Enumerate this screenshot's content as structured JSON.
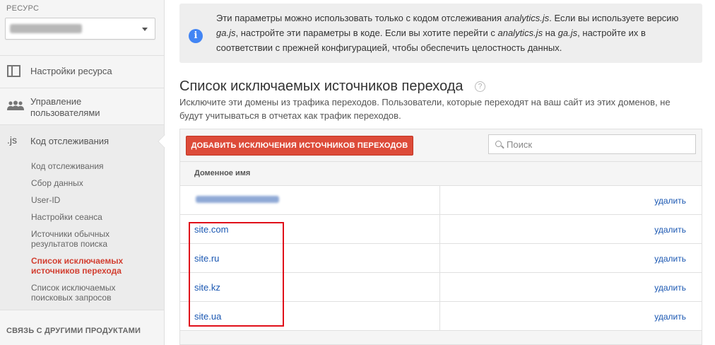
{
  "sidebar": {
    "resource_label": "РЕСУРС",
    "resource_value_blurred": "",
    "sections": {
      "resource_settings": "Настройки ресурса",
      "user_management": "Управление пользователями",
      "tracking_code": "Код отслеживания",
      "tracking_code_icon": ".js"
    },
    "sub_items": [
      "Код отслеживания",
      "Сбор данных",
      "User-ID",
      "Настройки сеанса",
      "Источники обычных результатов поиска",
      "Список исключаемых источников перехода",
      "Список исключаемых поисковых запросов"
    ],
    "active_sub_item": 5,
    "related_products_label": "СВЯЗЬ С ДРУГИМИ ПРОДУКТАМИ"
  },
  "info": {
    "text_1": "Эти параметры можно использовать только с кодом отслеживания ",
    "code_1": "analytics.js",
    "text_2": ". Если вы используете версию ",
    "code_2": "ga.js",
    "text_3": ", настройте эти параметры в коде. Если вы хотите перейти с ",
    "code_3": "analytics.js",
    "text_4": " на ",
    "code_4": "ga.js",
    "text_5": ", настройте их в соответствии с прежней конфигурацией, чтобы обеспечить целостность данных.",
    "icon": "i"
  },
  "main": {
    "title": "Список исключаемых источников перехода",
    "help_icon": "?",
    "description": "Исключите эти домены из трафика переходов. Пользователи, которые переходят на ваш сайт из этих доменов, не будут учитываться в отчетах как трафик переходов.",
    "add_button": "ДОБАВИТЬ ИСКЛЮЧЕНИЯ ИСТОЧНИКОВ ПЕРЕХОДОВ",
    "search_placeholder": "Поиск",
    "column_header": "Доменное имя",
    "rows": [
      {
        "domain": "",
        "blurred": true,
        "action": "удалить"
      },
      {
        "domain": "site.com",
        "action": "удалить"
      },
      {
        "domain": "site.ru",
        "action": "удалить"
      },
      {
        "domain": "site.kz",
        "action": "удалить"
      },
      {
        "domain": "site.ua",
        "action": "удалить"
      }
    ]
  },
  "colors": {
    "accent_red": "#dd4b39",
    "link_blue": "#1a57b2",
    "active_red": "#d23f31",
    "info_blue": "#4285f4",
    "highlight_red": "#e0101a"
  }
}
